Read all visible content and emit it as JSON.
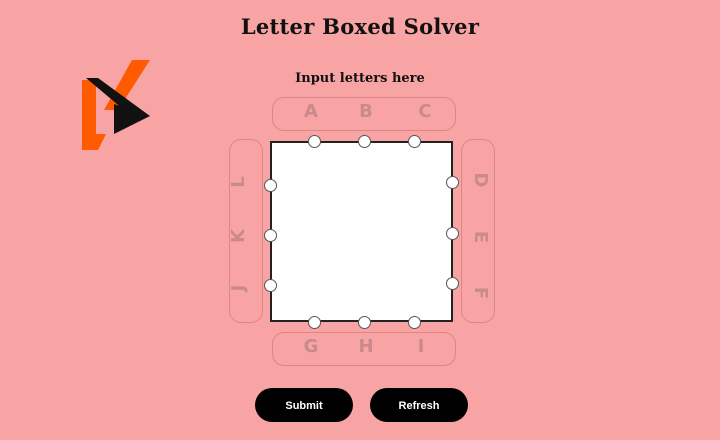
{
  "title": "Letter Boxed Solver",
  "subtitle": "Input letters here",
  "letters": {
    "top": [
      "A",
      "B",
      "C"
    ],
    "right": [
      "D",
      "E",
      "F"
    ],
    "bottom": [
      "G",
      "H",
      "I"
    ],
    "left": [
      "J",
      "K",
      "L"
    ]
  },
  "buttons": {
    "submit": "Submit",
    "refresh": "Refresh"
  },
  "colors": {
    "background": "#f8a4a4",
    "logo_orange": "#ff5a00",
    "logo_black": "#111111",
    "button": "#000000",
    "letter": "#c88a8a"
  },
  "icons": {
    "logo": "brand-logo"
  }
}
